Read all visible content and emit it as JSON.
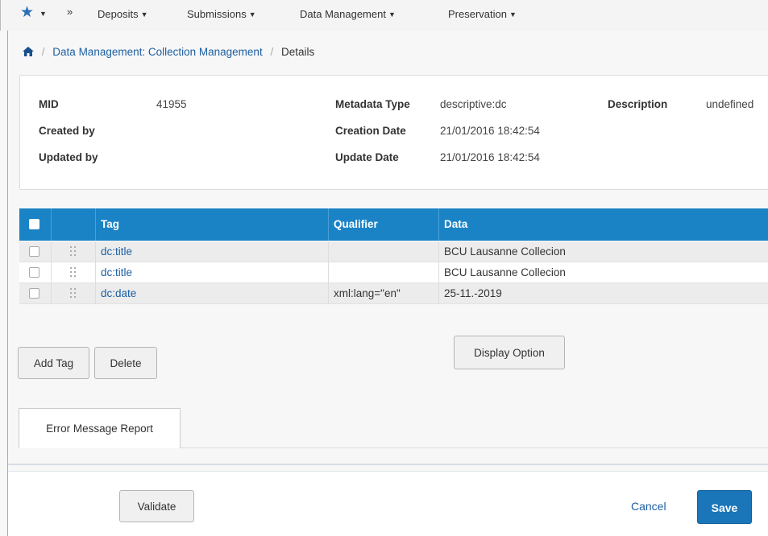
{
  "nav": {
    "items": [
      {
        "label": "Deposits"
      },
      {
        "label": "Submissions"
      },
      {
        "label": "Data Management"
      },
      {
        "label": "Preservation"
      }
    ],
    "more_glyph": "»"
  },
  "breadcrumb": {
    "link": "Data Management: Collection Management",
    "current": "Details"
  },
  "details": {
    "mid_label": "MID",
    "mid_value": "41955",
    "created_by_label": "Created by",
    "updated_by_label": "Updated by",
    "metadata_type_label": "Metadata Type",
    "metadata_type_value": "descriptive:dc",
    "creation_date_label": "Creation Date",
    "creation_date_value": "21/01/2016 18:42:54",
    "update_date_label": "Update Date",
    "update_date_value": "21/01/2016 18:42:54",
    "description_label": "Description",
    "description_value": "undefined"
  },
  "table": {
    "columns": [
      "Tag",
      "Qualifier",
      "Data"
    ],
    "rows": [
      {
        "tag": "dc:title",
        "qualifier": "",
        "data": "BCU Lausanne Collecion"
      },
      {
        "tag": "dc:title",
        "qualifier": "",
        "data": "BCU Lausanne Collecion"
      },
      {
        "tag": "dc:date",
        "qualifier": "xml:lang=\"en\"",
        "data": "25-11.-2019"
      }
    ]
  },
  "actions": {
    "add_tag": "Add Tag",
    "delete": "Delete",
    "display_option": "Display Option"
  },
  "tabs": {
    "error_report": "Error Message Report"
  },
  "footer": {
    "validate": "Validate",
    "cancel": "Cancel",
    "save": "Save"
  },
  "colors": {
    "accent": "#1a83c6",
    "save_button": "#1a76b9",
    "link": "#1d5fa3"
  },
  "icons": [
    "star-icon",
    "chevron-down-icon",
    "double-chevron-icon",
    "home-icon",
    "drag-handle-icon",
    "checkbox-icon"
  ]
}
